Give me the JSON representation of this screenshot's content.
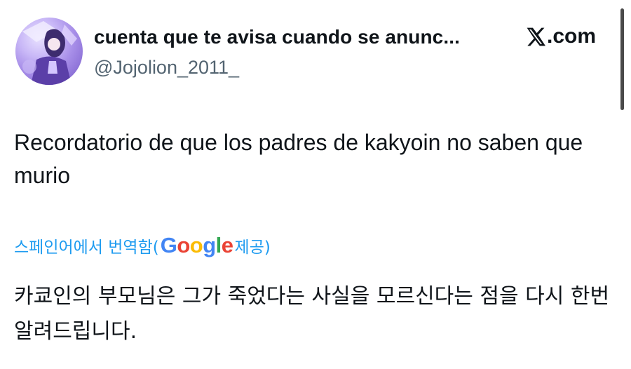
{
  "header": {
    "display_name": "cuenta que te avisa cuando se anunc...",
    "handle": "@Jojolion_2011_",
    "site_label": ".com",
    "avatar_icon": "avatar-purple-character-icon",
    "logo_icon": "x-logo-icon"
  },
  "tweet": {
    "text": "Recordatorio de que los padres de kakyoin no saben que murio"
  },
  "translation": {
    "prefix": "스페인어에서 번역함(",
    "provider": {
      "letters": [
        "G",
        "o",
        "o",
        "g",
        "l",
        "e"
      ]
    },
    "suffix": " 제공)",
    "text": "카쿄인의 부모님은 그가 죽었다는 사실을 모르신다는 점을 다시 한번 알려드립니다."
  },
  "colors": {
    "link": "#1d9bf0",
    "muted": "#536471",
    "text": "#0f1419"
  }
}
